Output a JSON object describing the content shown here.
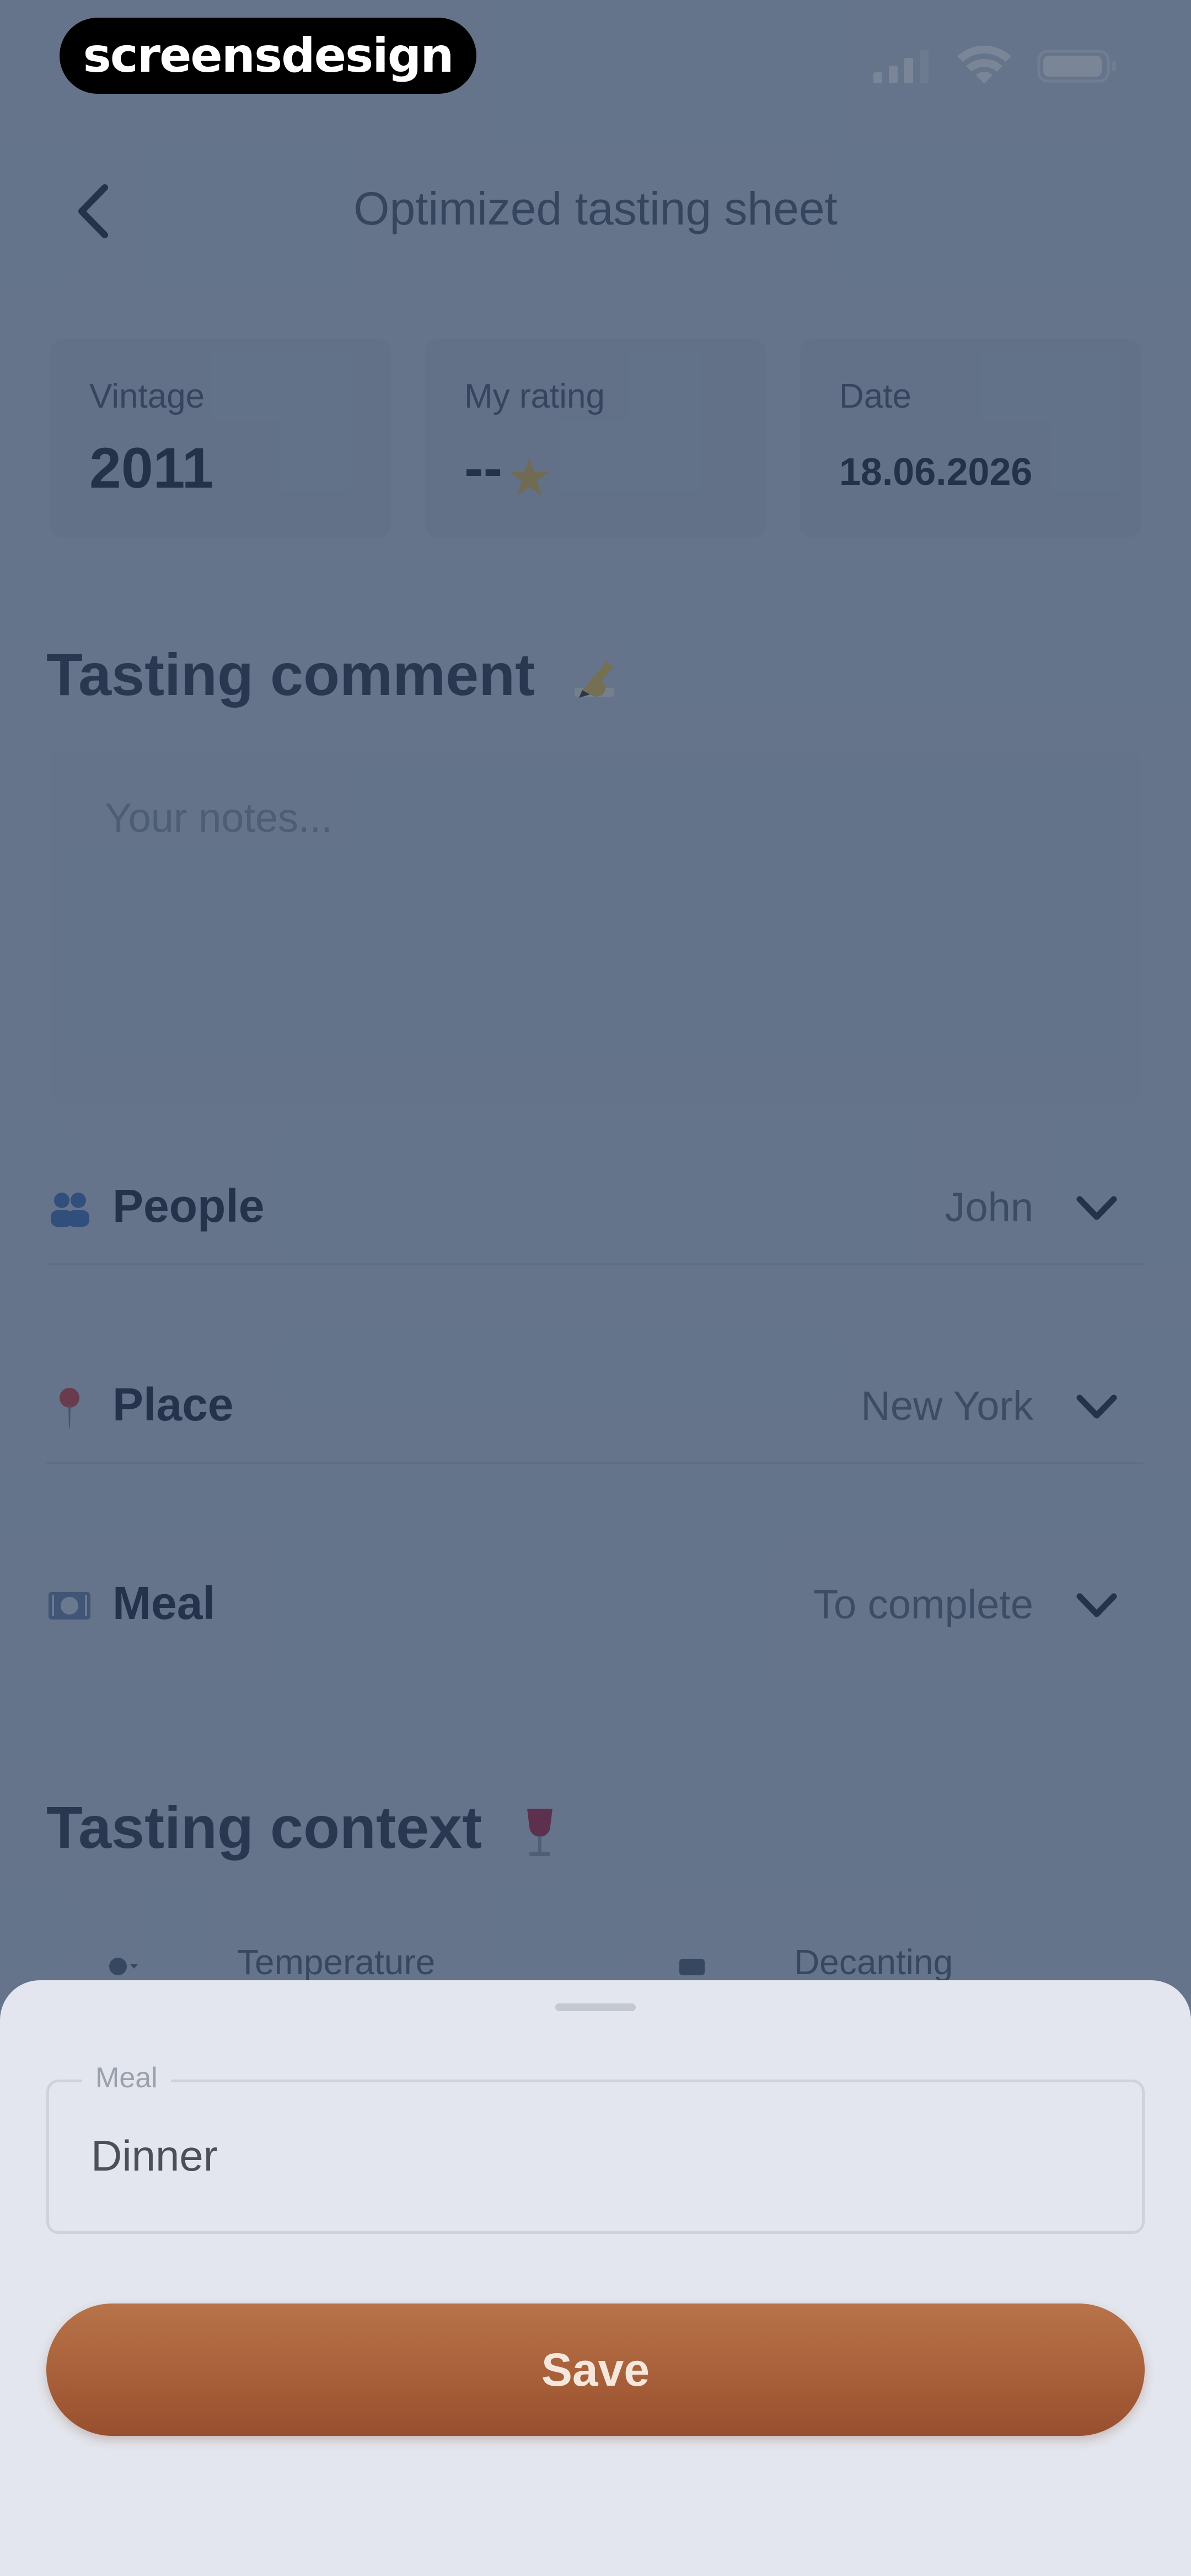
{
  "status_bar": {
    "watermark": "screensdesign"
  },
  "header": {
    "title": "Optimized tasting sheet"
  },
  "summary": {
    "vintage_label": "Vintage",
    "vintage_value": "2011",
    "rating_label": "My rating",
    "rating_value": "--",
    "date_label": "Date",
    "date_value": "18.06.2026"
  },
  "tasting_comment": {
    "title": "Tasting comment",
    "notes_placeholder": "Your notes..."
  },
  "rows": {
    "people": {
      "label": "People",
      "value": "John"
    },
    "place": {
      "label": "Place",
      "value": "New York"
    },
    "meal": {
      "label": "Meal",
      "value": "To complete"
    }
  },
  "tasting_context": {
    "title": "Tasting context",
    "temperature_label": "Temperature",
    "decanting_label": "Decanting"
  },
  "sheet": {
    "field_label": "Meal",
    "field_value": "Dinner",
    "save_label": "Save"
  },
  "colors": {
    "accent": "#a65e38",
    "overlay": "#58687d",
    "sheet_bg": "#e3e6ee"
  }
}
